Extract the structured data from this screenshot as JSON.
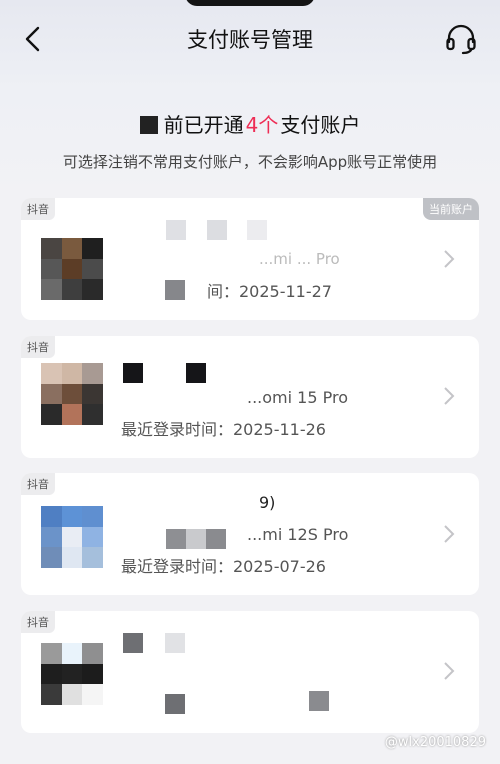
{
  "header": {
    "title": "支付账号管理"
  },
  "summary": {
    "prefix": "前已开通",
    "count": "4个",
    "suffix": "支付账户"
  },
  "subtitle": "可选择注销不常用支付账户，不会影响App账号正常使用",
  "accounts": [
    {
      "platform": "抖音",
      "current_badge": "当前账户",
      "device": "...mi ... Pro",
      "login_time": "间：2025-11-27"
    },
    {
      "platform": "抖音",
      "device": "...omi 15 Pro",
      "login_time": "最近登录时间：2025-11-26"
    },
    {
      "platform": "抖音",
      "name_fragment": "9)",
      "device": "...mi 12S Pro",
      "login_time": "最近登录时间：2025-07-26"
    },
    {
      "platform": "抖音"
    }
  ],
  "watermark": "@wlx20010829",
  "colors": {
    "accent": "#ee2d55",
    "card_bg": "#ffffff",
    "page_bg": "#f2f2f5"
  }
}
